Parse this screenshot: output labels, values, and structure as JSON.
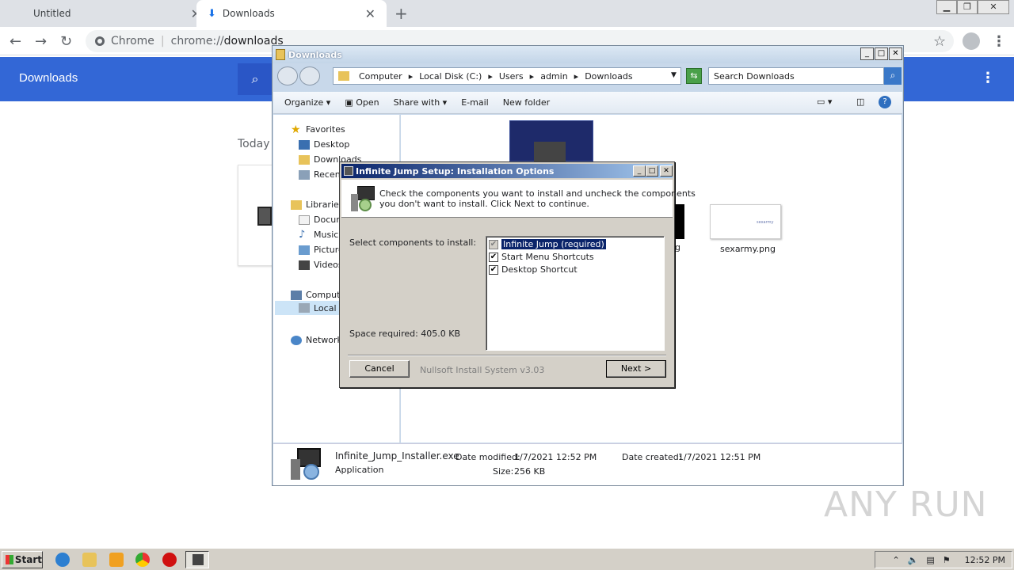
{
  "browser": {
    "tabs": [
      {
        "label": "Untitled"
      },
      {
        "label": "Downloads"
      }
    ],
    "omnibox": {
      "scheme_label": "Chrome",
      "url_scheme": "chrome://",
      "url_host": "downloads"
    },
    "page": {
      "title": "Downloads",
      "section": "Today"
    }
  },
  "explorer": {
    "title": "Downloads",
    "breadcrumb": [
      "Computer",
      "Local Disk (C:)",
      "Users",
      "admin",
      "Downloads"
    ],
    "search_placeholder": "Search Downloads",
    "commands": {
      "organize": "Organize",
      "open": "Open",
      "share": "Share with",
      "email": "E-mail",
      "new_folder": "New folder"
    },
    "nav": {
      "favorites": "Favorites",
      "desktop": "Desktop",
      "downloads": "Downloads",
      "recent": "Recen",
      "libraries": "Libraries",
      "documents": "Docum",
      "music": "Music",
      "pictures": "Picture",
      "videos": "Videos",
      "computer": "Compute",
      "local_disk": "Local D",
      "network": "Network"
    },
    "files": [
      {
        "name": "g"
      },
      {
        "name": "sexarmy.png",
        "thumb_text": "sexarmy"
      }
    ],
    "details": {
      "file_name": "Infinite_Jump_Installer.exe",
      "file_type": "Application",
      "date_modified_label": "Date modified:",
      "date_modified": "1/7/2021 12:52 PM",
      "date_created_label": "Date created:",
      "date_created": "1/7/2021 12:51 PM",
      "size_label": "Size:",
      "size": "256 KB"
    }
  },
  "dialog": {
    "title": "Infinite Jump Setup: Installation Options",
    "instructions_line1": "Check the components you want to install and uncheck the components",
    "instructions_line2": "you don't want to install. Click Next to continue.",
    "select_label": "Select components to install:",
    "components": [
      {
        "label": "Infinite Jump (required)",
        "checked": true,
        "disabled": true,
        "selected": true
      },
      {
        "label": "Start Menu Shortcuts",
        "checked": true
      },
      {
        "label": "Desktop Shortcut",
        "checked": true
      }
    ],
    "space_required": "Space required: 405.0 KB",
    "cancel": "Cancel",
    "branding": "Nullsoft Install System v3.03",
    "next": "Next >"
  },
  "taskbar": {
    "start": "Start",
    "clock": "12:52 PM"
  },
  "watermark": "ANY RUN",
  "colors": {
    "chrome_blue": "#3367d6",
    "dialog_title": "#0a246a",
    "win_face": "#d4d0c8"
  }
}
